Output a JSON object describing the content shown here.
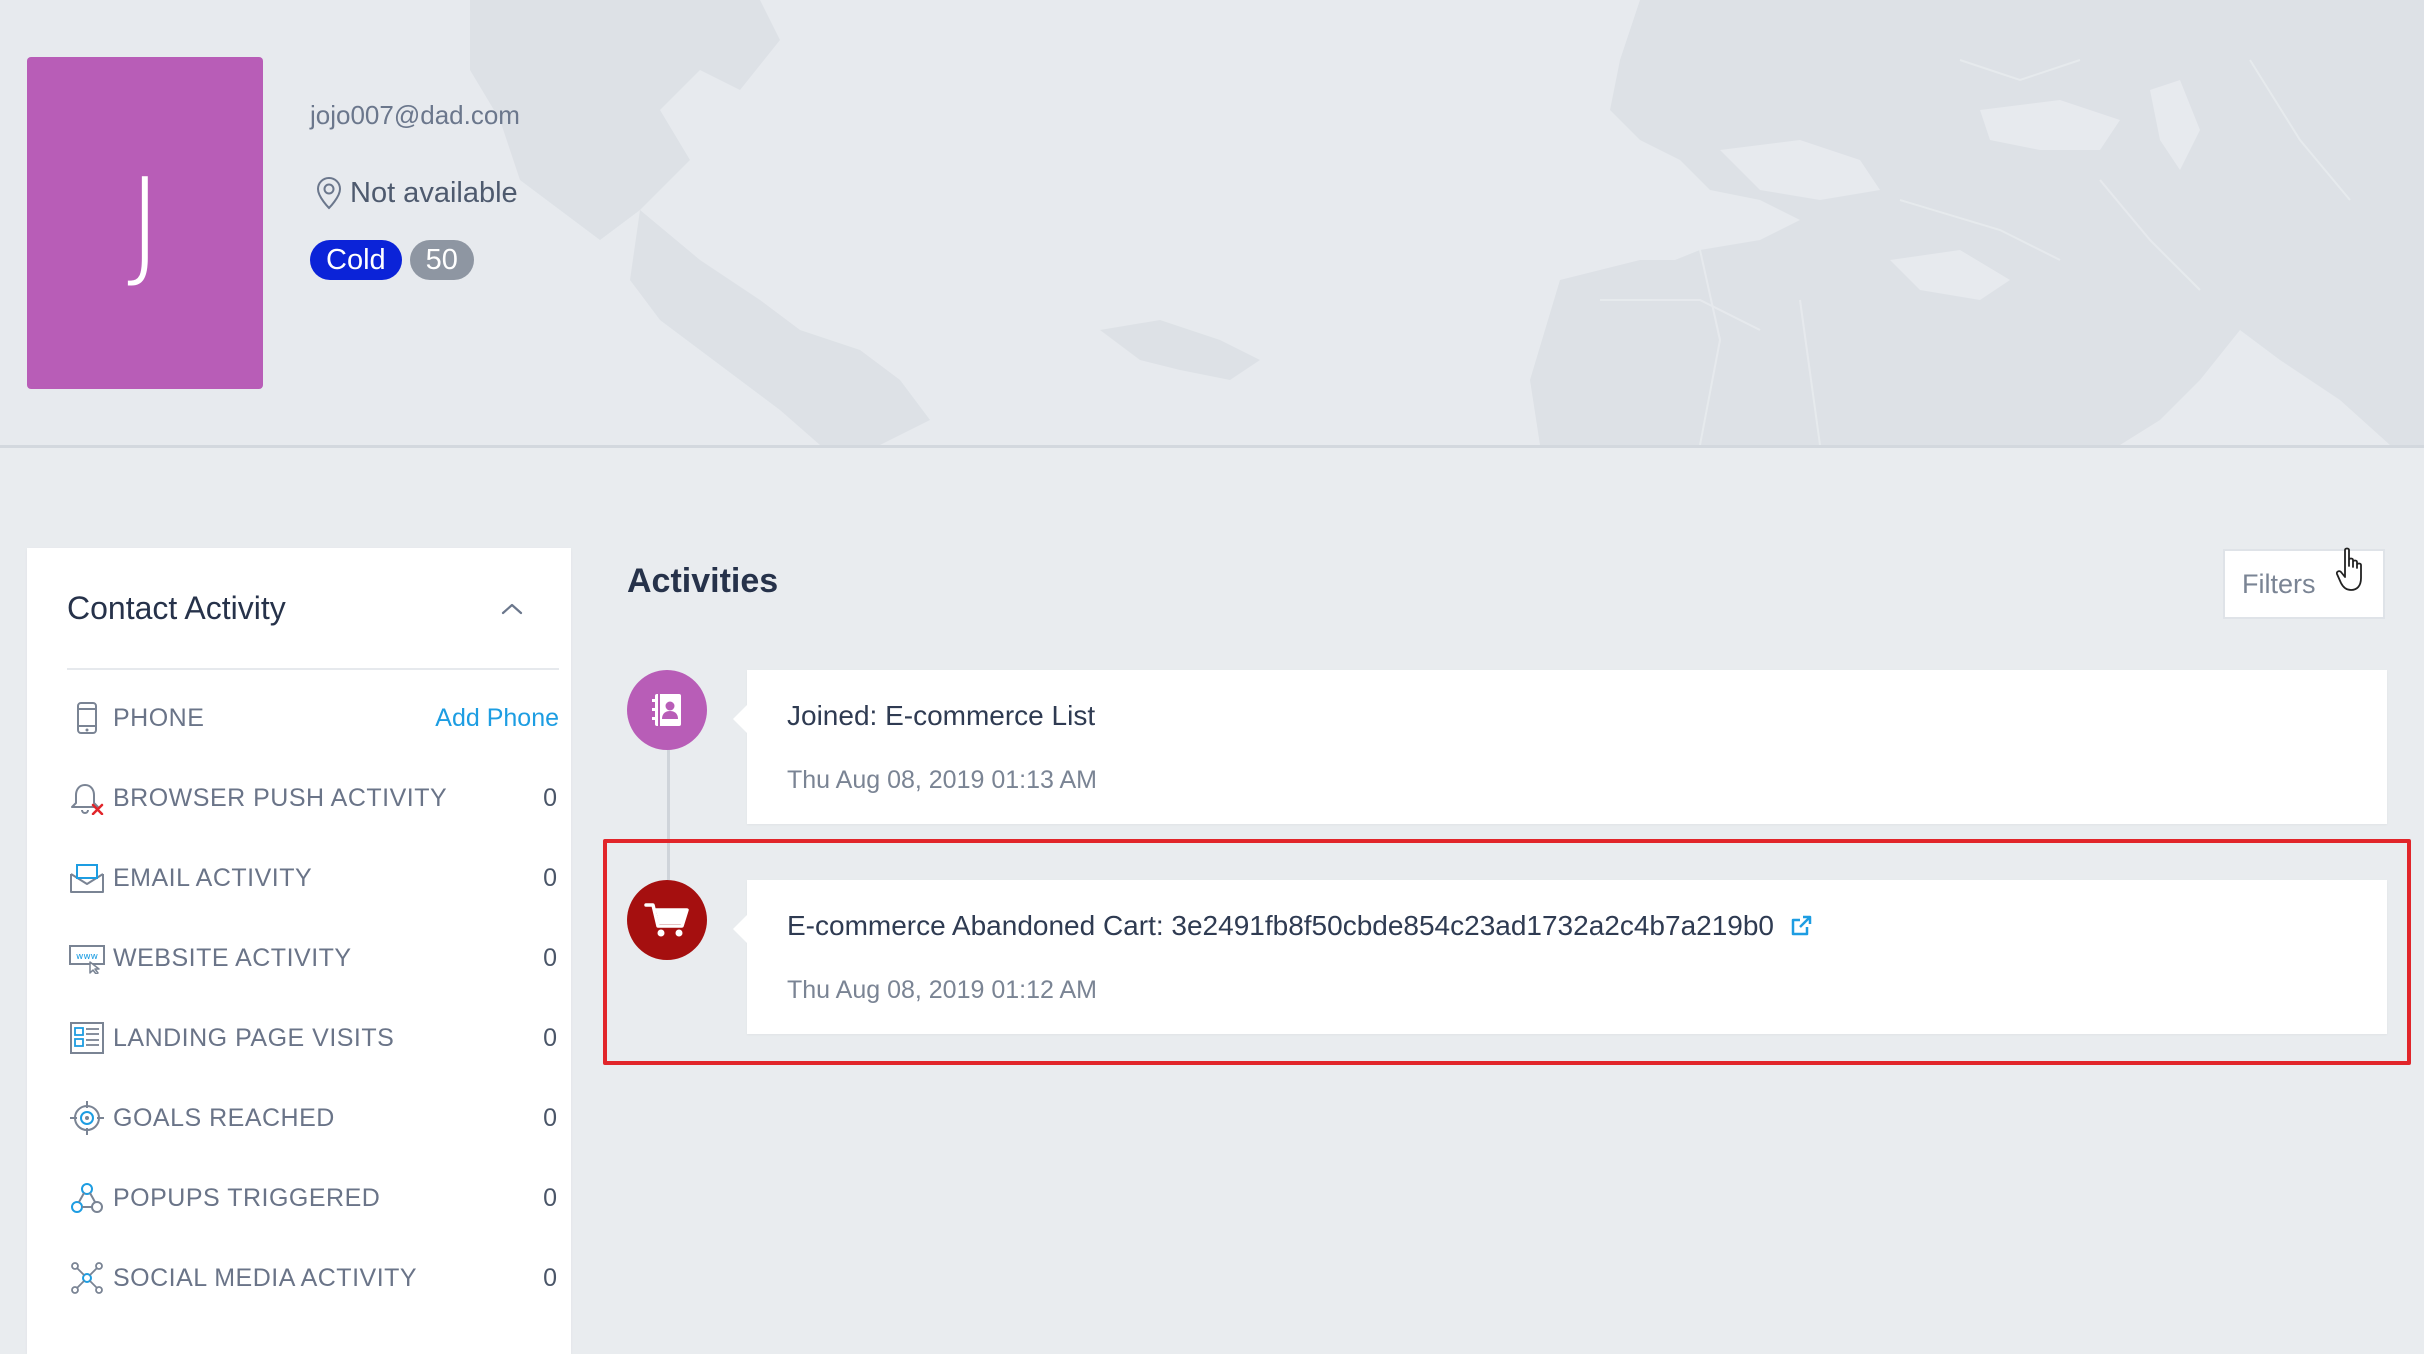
{
  "profile": {
    "initial": "J",
    "avatar_color": "#b85db7",
    "email": "jojo007@dad.com",
    "location": "Not available",
    "status_badge": "Cold",
    "score_badge": "50"
  },
  "left_panel": {
    "title": "Contact Activity",
    "rows": [
      {
        "label": "PHONE",
        "action": "Add Phone",
        "icon": "phone-icon"
      },
      {
        "label": "BROWSER PUSH ACTIVITY",
        "count": "0",
        "icon": "bell-off-icon"
      },
      {
        "label": "EMAIL ACTIVITY",
        "count": "0",
        "icon": "email-open-icon"
      },
      {
        "label": "WEBSITE ACTIVITY",
        "count": "0",
        "icon": "website-icon"
      },
      {
        "label": "LANDING PAGE VISITS",
        "count": "0",
        "icon": "landing-page-icon"
      },
      {
        "label": "GOALS REACHED",
        "count": "0",
        "icon": "target-icon"
      },
      {
        "label": "POPUPS TRIGGERED",
        "count": "0",
        "icon": "popup-icon"
      },
      {
        "label": "SOCIAL MEDIA ACTIVITY",
        "count": "0",
        "icon": "social-network-icon"
      }
    ]
  },
  "activities": {
    "title": "Activities",
    "filters_label": "Filters",
    "items": [
      {
        "title": "Joined: E-commerce List",
        "time": "Thu Aug 08, 2019 01:13 AM",
        "icon": "contact-book-icon",
        "color": "#b85db7"
      },
      {
        "title": "E-commerce Abandoned Cart: 3e2491fb8f50cbde854c23ad1732a2c4b7a219b0",
        "time": "Thu Aug 08, 2019 01:12 AM",
        "icon": "shopping-cart-icon",
        "color": "#a50f0f"
      }
    ]
  },
  "colors": {
    "accent_blue": "#1d9de2",
    "cold_badge": "#0b23d8",
    "highlight": "#e1252a"
  }
}
